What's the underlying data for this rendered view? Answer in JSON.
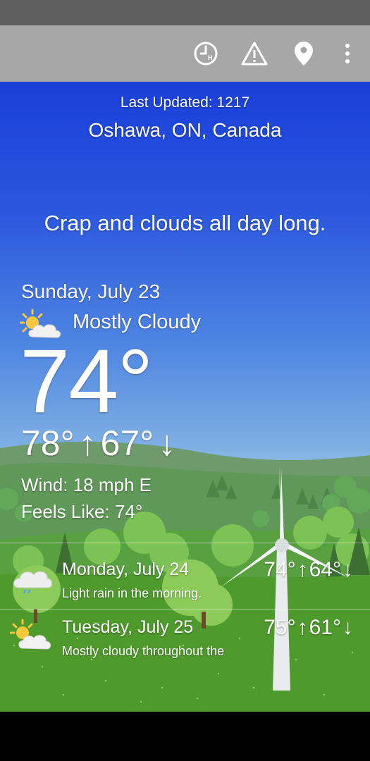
{
  "toolbar": {
    "icons": [
      "history-clock-icon",
      "alert-triangle-icon",
      "location-pin-icon",
      "overflow-menu-icon"
    ]
  },
  "current": {
    "last_updated": "Last Updated: 1217",
    "location": "Oshawa, ON, Canada",
    "summary": "Crap and clouds all day long.",
    "date": "Sunday, July 23",
    "condition": "Mostly Cloudy",
    "condition_icon": "partly-cloudy-icon",
    "temperature": "74°",
    "high": "78°",
    "low": "67°",
    "up_arrow": "↑",
    "down_arrow": "↓",
    "wind": "Wind: 18 mph E",
    "feels_like": "Feels Like: 74°"
  },
  "forecast": [
    {
      "day": "Monday, July 24",
      "description": "Light rain in the morning.",
      "icon": "rain-cloud-icon",
      "high": "74°",
      "low": "64°"
    },
    {
      "day": "Tuesday, July 25",
      "description": "Mostly cloudy throughout the",
      "icon": "partly-cloudy-icon",
      "high": "75°",
      "low": "61°"
    }
  ],
  "colors": {
    "sky_top": "#1a3fd8",
    "grass": "#4f9a2c",
    "toolbar": "#a7a7a7",
    "status_bar": "#5f5f5f"
  }
}
